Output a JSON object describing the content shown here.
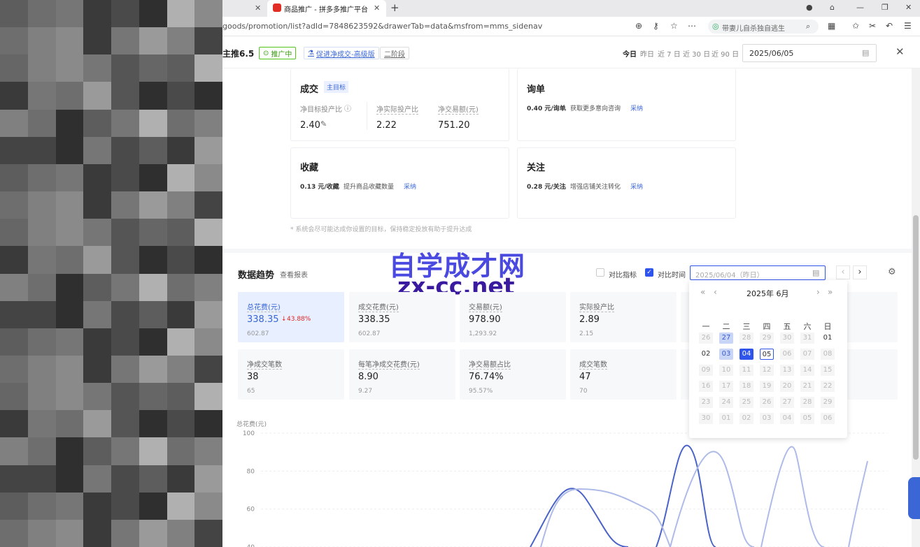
{
  "browser": {
    "tab_title": "商品推广 - 拼多多推广平台",
    "url": "goods/promotion/list?adId=7848623592&drawerTab=data&msfrom=mms_sidenav",
    "search_placeholder": "带妻儿自杀独自逃生"
  },
  "header": {
    "title": "主推6.5",
    "status": "推广中",
    "upgrade": "促进净成交-高级版",
    "stage": "二阶段",
    "date_links": [
      "今日",
      "昨日",
      "近 7 日",
      "近 30 日",
      "近 90 日"
    ],
    "date_value": "2025/06/05"
  },
  "goals": {
    "deal": {
      "title": "成交",
      "tag": "主目标",
      "items": [
        {
          "label": "净目标投产比",
          "value": "2.40"
        },
        {
          "label": "净实际投产比",
          "value": "2.22"
        },
        {
          "label": "净交易额(元)",
          "value": "751.20"
        }
      ]
    },
    "inquiry": {
      "title": "询单",
      "price": "0.40 元/询单",
      "desc": "，获取更多意向咨询",
      "action": "采纳"
    },
    "favorite": {
      "title": "收藏",
      "price": "0.13 元/收藏",
      "desc": "，提升商品收藏数量",
      "action": "采纳"
    },
    "follow": {
      "title": "关注",
      "price": "0.28 元/关注",
      "desc": "，增强店铺关注转化",
      "action": "采纳"
    },
    "note": "* 系统会尽可能达成你设置的目标，保持稳定投放有助于提升达成"
  },
  "trend": {
    "title": "数据趋势",
    "report_link": "查看报表",
    "compare_metric": "对比指标",
    "compare_time": "对比时间",
    "compare_date": "2025/06/04（昨日）",
    "metrics": [
      {
        "label": "总花费(元)",
        "value": "338.35",
        "change": "43.88%",
        "sub": "602.87"
      },
      {
        "label": "成交花费(元)",
        "value": "338.35",
        "sub": "602.87"
      },
      {
        "label": "交易额(元)",
        "value": "978.90",
        "sub": "1,293.92"
      },
      {
        "label": "实际投产比",
        "value": "2.89",
        "sub": "2.15"
      },
      {
        "label": "净成交笔数",
        "value": "38",
        "sub": "65"
      },
      {
        "label": "每笔净成交花费(元)",
        "value": "8.90",
        "sub": "9.27"
      },
      {
        "label": "净交易额占比",
        "value": "76.74%",
        "sub": "95.57%"
      },
      {
        "label": "成交笔数",
        "value": "47",
        "sub": "70"
      }
    ]
  },
  "calendar": {
    "title": "2025年 6月",
    "weekdays": [
      "一",
      "二",
      "三",
      "四",
      "五",
      "六",
      "日"
    ],
    "rows": [
      [
        "26",
        "27",
        "28",
        "29",
        "30",
        "31",
        "01"
      ],
      [
        "02",
        "03",
        "04",
        "05",
        "06",
        "07",
        "08"
      ],
      [
        "09",
        "10",
        "11",
        "12",
        "13",
        "14",
        "15"
      ],
      [
        "16",
        "17",
        "18",
        "19",
        "20",
        "21",
        "22"
      ],
      [
        "23",
        "24",
        "25",
        "26",
        "27",
        "28",
        "29"
      ],
      [
        "30",
        "01",
        "02",
        "03",
        "04",
        "05",
        "06"
      ]
    ]
  },
  "watermark": {
    "text": "自学成才网",
    "url": "zx-cc.net"
  },
  "chart_data": {
    "type": "line",
    "ylabel": "总花费(元)",
    "yticks": [
      "100",
      "80",
      "60",
      "40"
    ],
    "ylim": [
      40,
      100
    ]
  },
  "colors": {
    "accent": "#2f54eb",
    "selected_bg": "#e8efff",
    "down": "#e02424",
    "line_dark": "#4a63c8",
    "line_light": "#aebbe8"
  }
}
